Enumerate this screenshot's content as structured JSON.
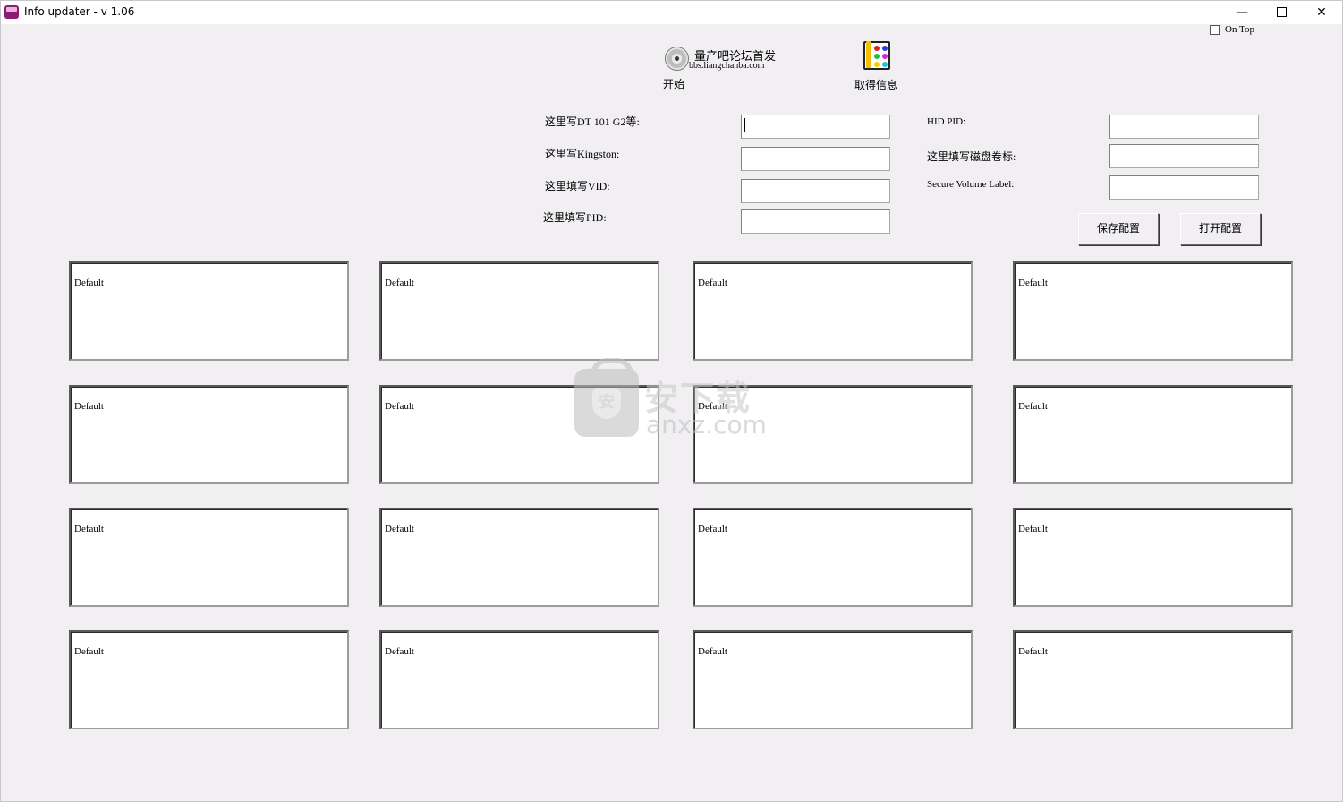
{
  "window": {
    "title": "Info updater - v 1.06",
    "controls": {
      "minimize": "—",
      "maximize": "",
      "close": "✕"
    }
  },
  "ontop": {
    "label": "On Top",
    "checked": false
  },
  "toolbar": {
    "start_label": "开始",
    "forum_title": "量产吧论坛首发",
    "forum_url": "bbs.liangchanba.com",
    "get_info_label": "取得信息"
  },
  "form": {
    "left": [
      {
        "label": "这里写DT 101 G2等:",
        "value": ""
      },
      {
        "label": "这里写Kingston:",
        "value": ""
      },
      {
        "label": "这里填写VID:",
        "value": ""
      },
      {
        "label": "这里填写PID:",
        "value": ""
      }
    ],
    "right": [
      {
        "label": "HID PID:",
        "value": ""
      },
      {
        "label": "这里填写磁盘卷标:",
        "value": ""
      },
      {
        "label": "Secure Volume Label:",
        "value": ""
      }
    ]
  },
  "buttons": {
    "save": "保存配置",
    "open": "打开配置"
  },
  "grid": {
    "cells": [
      "Default",
      "Default",
      "Default",
      "Default",
      "Default",
      "Default",
      "Default",
      "Default",
      "Default",
      "Default",
      "Default",
      "Default",
      "Default",
      "Default",
      "Default",
      "Default"
    ]
  },
  "watermark": {
    "top": "安下载",
    "bottom": "anxz.com",
    "badge": "安"
  }
}
